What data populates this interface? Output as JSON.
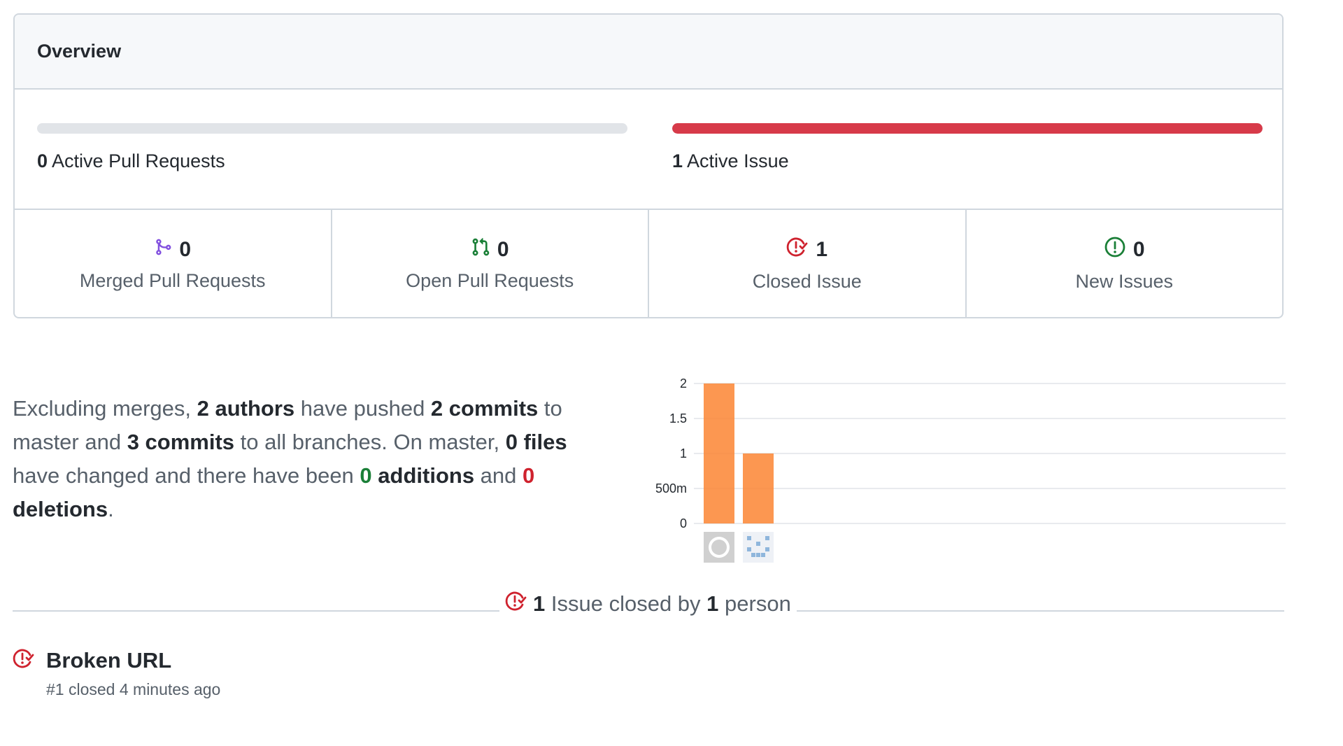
{
  "overview": {
    "title": "Overview",
    "active_prs": {
      "count": "0",
      "label": "Active Pull Requests",
      "fill_fraction": 0,
      "color": "#e1e4e8"
    },
    "active_issues": {
      "count": "1",
      "label": "Active Issue",
      "fill_fraction": 1,
      "color": "#d73a49"
    },
    "stats": [
      {
        "icon": "git-merge-icon",
        "count": "0",
        "label": "Merged Pull Requests",
        "color": "#8250df"
      },
      {
        "icon": "git-pull-request-icon",
        "count": "0",
        "label": "Open Pull Requests",
        "color": "#1a7f37"
      },
      {
        "icon": "issue-closed-icon",
        "count": "1",
        "label": "Closed Issue",
        "color": "#cf222e"
      },
      {
        "icon": "issue-opened-icon",
        "count": "0",
        "label": "New Issues",
        "color": "#1a7f37"
      }
    ]
  },
  "summary": {
    "t1": "Excluding merges, ",
    "authors": "2 authors",
    "t2": " have pushed ",
    "commits_master": "2 commits",
    "t3": " to master and ",
    "commits_all": "3 commits",
    "t4": " to all branches. On master, ",
    "files": "0 files",
    "t5": " have changed and there have been ",
    "additions_count": "0",
    "additions_word": " additions",
    "t6": " and ",
    "deletions_count": "0",
    "deletions_word": " deletions",
    "t7": "."
  },
  "chart_data": {
    "type": "bar",
    "categories": [
      "author-1",
      "author-2"
    ],
    "values": [
      2,
      1
    ],
    "yticks": [
      "0",
      "500m",
      "1",
      "1.5",
      "2"
    ],
    "ylim": [
      0,
      2
    ],
    "grid": true,
    "bar_color": "#fb8532",
    "avatars": [
      "github-avatar-icon",
      "identicon-avatar-icon"
    ]
  },
  "closed_section": {
    "count": "1",
    "t1": " Issue closed by ",
    "people": "1",
    "t2": " person"
  },
  "issues": [
    {
      "title": "Broken URL",
      "meta": "#1 closed 4 minutes ago"
    }
  ]
}
